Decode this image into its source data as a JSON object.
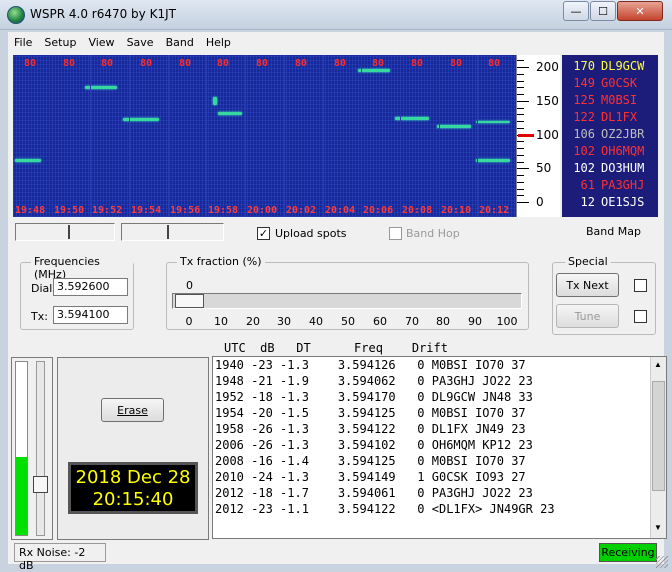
{
  "window": {
    "title": "WSPR 4.0 r6470    by K1JT",
    "minimize_glyph": "—",
    "maximize_glyph": "☐",
    "close_glyph": "✕"
  },
  "menu": [
    "File",
    "Setup",
    "View",
    "Save",
    "Band",
    "Help"
  ],
  "waterfall": {
    "top_labels": [
      "80",
      "80",
      "80",
      "80",
      "80",
      "80",
      "80",
      "80",
      "80",
      "80",
      "80",
      "80",
      "80"
    ],
    "times": [
      "19:48",
      "19:50",
      "19:52",
      "19:54",
      "19:56",
      "19:58",
      "20:00",
      "20:02",
      "20:04",
      "20:06",
      "20:08",
      "20:10",
      "20:12"
    ],
    "scale_labels": [
      "200",
      "150",
      "100",
      "50",
      "0"
    ]
  },
  "band_map": {
    "label": "Band Map",
    "rows": [
      {
        "freq": "170",
        "call": "DL9GCW",
        "color": "#ffff40"
      },
      {
        "freq": "149",
        "call": "G0CSK",
        "color": "#ff3030"
      },
      {
        "freq": "125",
        "call": "M0BSI",
        "color": "#ff3030"
      },
      {
        "freq": "122",
        "call": "DL1FX",
        "color": "#ff3030"
      },
      {
        "freq": "106",
        "call": "OZ2JBR",
        "color": "#bdbdbd"
      },
      {
        "freq": "102",
        "call": "OH6MQM",
        "color": "#ff3030"
      },
      {
        "freq": "102",
        "call": "DO3HUM",
        "color": "#ffffff"
      },
      {
        "freq": "61",
        "call": "PA3GHJ",
        "color": "#ff3030"
      },
      {
        "freq": "12",
        "call": "OE1SJS",
        "color": "#ffffff"
      }
    ]
  },
  "controls": {
    "upload_spots": "Upload spots",
    "upload_checked": "✓",
    "band_hop": "Band Hop"
  },
  "frequencies": {
    "title": "Frequencies (MHz)",
    "dial_label": "Dial:",
    "dial_value": "3.592600",
    "tx_label": "Tx:",
    "tx_value": "3.594100"
  },
  "tx_fraction": {
    "title": "Tx fraction (%)",
    "current": "0",
    "ticks": [
      "0",
      "10",
      "20",
      "30",
      "40",
      "50",
      "60",
      "70",
      "80",
      "90",
      "100"
    ]
  },
  "special": {
    "title": "Special",
    "tx_next": "Tx Next",
    "tune": "Tune"
  },
  "decodes": {
    "header": "UTC  dB   DT      Freq    Drift",
    "rows": [
      "1940 -23 -1.3    3.594126   0 M0BSI IO70 37",
      "1948 -21 -1.9    3.594062   0 PA3GHJ JO22 23",
      "1952 -18 -1.3    3.594170   0 DL9GCW JN48 33",
      "1954 -20 -1.5    3.594125   0 M0BSI IO70 37",
      "1958 -26 -1.3    3.594122   0 DL1FX JN49 23",
      "2006 -26 -1.3    3.594102   0 OH6MQM KP12 23",
      "2008 -16 -1.4    3.594125   0 M0BSI IO70 37",
      "2010 -24 -1.3    3.594149   1 G0CSK IO93 27",
      "2012 -18 -1.7    3.594061   0 PA3GHJ JO22 23",
      "2012 -23 -1.1    3.594122   0 <DL1FX> JN49GR 23"
    ]
  },
  "erase_label": "Erase",
  "clock": {
    "date": "2018 Dec 28",
    "time": "20:15:40"
  },
  "rx_meter_level": 0.45,
  "status": {
    "rx_noise": "Rx Noise:  -2  dB",
    "receiving": "Receiving"
  }
}
